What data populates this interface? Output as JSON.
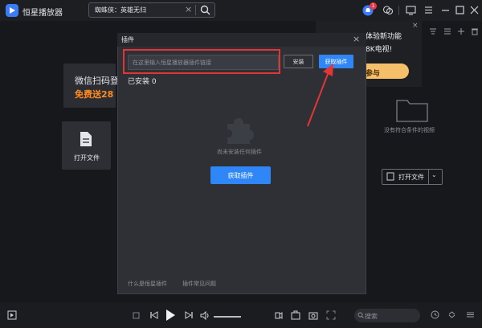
{
  "app": {
    "title": "恒星播放器",
    "caret": "⌄",
    "search_text": "蜘蛛侠：英雄无归",
    "notif_count": "1"
  },
  "left": {
    "wx_line1": "微信扫码登",
    "wx_line2": "免费送28",
    "open_file": "打开文件"
  },
  "promo": {
    "line1": "体验新功能",
    "line2": "8K电视!",
    "button": "参与"
  },
  "right": {
    "no_video": "没有符合条件的视频",
    "open_file": "打开文件",
    "caret": "⌄"
  },
  "modal": {
    "title": "插件",
    "input_placeholder": "在这里输入恒星播放器插件链接",
    "install": "安装",
    "get_plugin": "获取插件",
    "installed": "已安装 0",
    "empty": "尚未安装任何插件",
    "get_plugin_center": "获取插件",
    "link_what": "什么是恒星插件",
    "link_faq": "插件常见问题"
  },
  "bottom": {
    "search_placeholder": "搜索"
  },
  "colors": {
    "accent": "#2f86f6",
    "highlight": "#e23636",
    "promo": "#f6c06a",
    "orange_text": "#ff8a1f"
  }
}
